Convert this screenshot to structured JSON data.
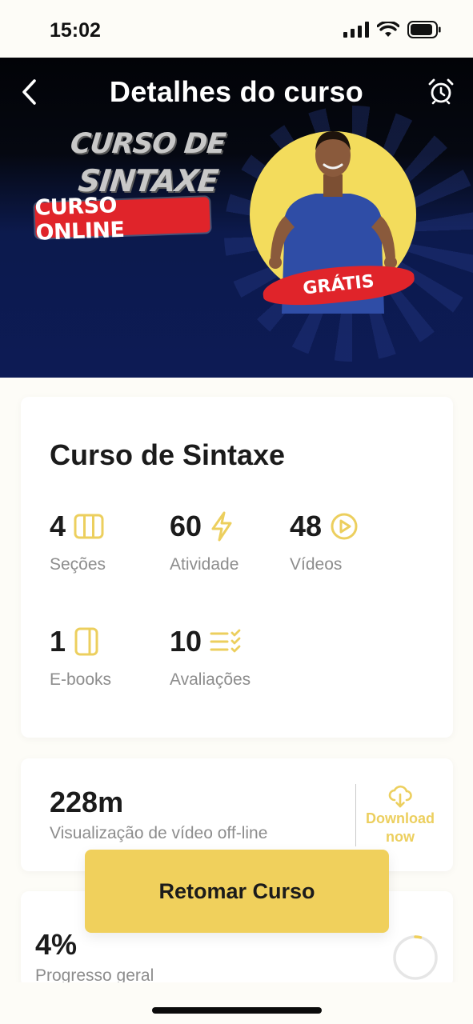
{
  "status_bar": {
    "time": "15:02"
  },
  "header": {
    "title": "Detalhes do curso"
  },
  "banner": {
    "line1": "CURSO DE",
    "line2": "SINTAXE",
    "ribbon": "CURSO ONLINE",
    "badge": "GRÁTIS"
  },
  "course": {
    "title": "Curso de Sintaxe",
    "stats": [
      {
        "value": "4",
        "label": "Seções",
        "icon": "columns-icon"
      },
      {
        "value": "60",
        "label": "Atividade",
        "icon": "lightning-icon"
      },
      {
        "value": "48",
        "label": "Vídeos",
        "icon": "play-circle-icon"
      },
      {
        "value": "1",
        "label": "E-books",
        "icon": "book-icon"
      },
      {
        "value": "10",
        "label": "Avaliações",
        "icon": "checklist-icon"
      }
    ]
  },
  "offline": {
    "value": "228m",
    "label": "Visualização de vídeo off-line",
    "download_label": "Download now"
  },
  "resume_button": {
    "label": "Retomar Curso"
  },
  "progress": {
    "value": "4%",
    "label": "Progresso geral",
    "fraction": 0.04
  },
  "colors": {
    "accent": "#f0d05c",
    "icon_yellow": "#eccf5e",
    "hero_blue": "#0d1b55",
    "ribbon_red": "#e0242a"
  }
}
